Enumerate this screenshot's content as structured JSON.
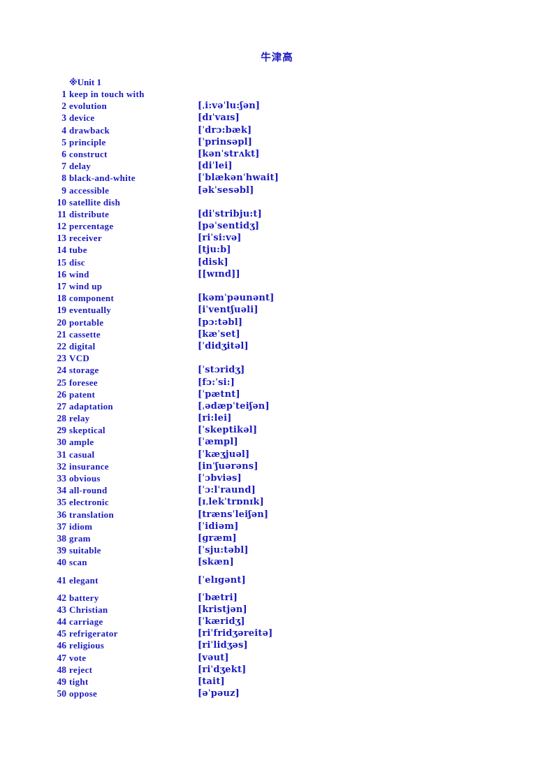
{
  "document": {
    "title": "牛津高",
    "unit_marker": "※",
    "unit_label": "Unit 1",
    "text_color": "#1a1ac0",
    "background_color": "#ffffff"
  },
  "vocab": [
    {
      "num": "1",
      "word": "keep in touch with",
      "ipa": ""
    },
    {
      "num": "2",
      "word": "evolution",
      "ipa": "[ˌi:vəˈlu:ʃən]"
    },
    {
      "num": "3",
      "word": "device",
      "ipa": "[dɪˈvaɪs]"
    },
    {
      "num": "4",
      "word": "drawback",
      "ipa": "[ˈdrɔ:bæk]"
    },
    {
      "num": "5",
      "word": "principle",
      "ipa": "[ˈprinsəpl]"
    },
    {
      "num": "6",
      "word": "construct",
      "ipa": "[kənˈstrʌkt]"
    },
    {
      "num": "7",
      "word": "delay",
      "ipa": "[diˈlei]"
    },
    {
      "num": "8",
      "word": "black-and-white",
      "ipa": "[ˈblækənˈhwait]"
    },
    {
      "num": "9",
      "word": "accessible",
      "ipa": "[əkˈsesəbl]"
    },
    {
      "num": "10",
      "word": "satellite dish",
      "ipa": ""
    },
    {
      "num": "11",
      "word": "distribute",
      "ipa": "[diˈstribju:t]"
    },
    {
      "num": "12",
      "word": "percentage",
      "ipa": "[pəˈsentidʒ]"
    },
    {
      "num": "13",
      "word": "receiver",
      "ipa": "[riˈsi:və]"
    },
    {
      "num": "14",
      "word": "tube",
      "ipa": "[tju:b]"
    },
    {
      "num": "15",
      "word": "disc",
      "ipa": "[disk]"
    },
    {
      "num": "16",
      "word": "wind",
      "ipa": "[[wɪnd]]"
    },
    {
      "num": "17",
      "word": "wind up",
      "ipa": ""
    },
    {
      "num": "18",
      "word": "component",
      "ipa": "[kəmˈpəunənt]"
    },
    {
      "num": "19",
      "word": "eventually",
      "ipa": "[iˈventʃuəli]"
    },
    {
      "num": "20",
      "word": "portable",
      "ipa": "[pɔ:təbl]"
    },
    {
      "num": "21",
      "word": "cassette",
      "ipa": "[kæˈset]"
    },
    {
      "num": "22",
      "word": "digital",
      "ipa": "[ˈdidʒitəl]"
    },
    {
      "num": "23",
      "word": "VCD",
      "ipa": ""
    },
    {
      "num": "24",
      "word": "storage",
      "ipa": "[ˈstɔridʒ]"
    },
    {
      "num": "25",
      "word": "foresee",
      "ipa": "[fɔ:ˈsi:]"
    },
    {
      "num": "26",
      "word": "patent",
      "ipa": "[ˈpætnt]"
    },
    {
      "num": "27",
      "word": "adaptation",
      "ipa": "[ˌədæpˈteiʃən]"
    },
    {
      "num": "28",
      "word": "relay",
      "ipa": "[ri:lei]"
    },
    {
      "num": "29",
      "word": "skeptical",
      "ipa": "[ˈskeptikəl]"
    },
    {
      "num": "30",
      "word": "ample",
      "ipa": "[ˈæmpl]"
    },
    {
      "num": "31",
      "word": "casual",
      "ipa": "[ˈkæʒjuəl]"
    },
    {
      "num": "32",
      "word": "insurance",
      "ipa": "[inˈʃuərəns]"
    },
    {
      "num": "33",
      "word": "obvious",
      "ipa": "[ˈɔbviəs]"
    },
    {
      "num": "34",
      "word": "all-round",
      "ipa": "[ˈɔ:lˈraund]"
    },
    {
      "num": "35",
      "word": "electronic",
      "ipa": "[ɪˌlekˈtrɒnɪk]"
    },
    {
      "num": "36",
      "word": "translation",
      "ipa": "[trænsˈleiʃən]"
    },
    {
      "num": "37",
      "word": "idiom",
      "ipa": "[ˈidiəm]"
    },
    {
      "num": "38",
      "word": "gram",
      "ipa": "[ɡræm]"
    },
    {
      "num": "39",
      "word": "suitable",
      "ipa": "[ˈsju:təbl]"
    },
    {
      "num": "40",
      "word": "scan",
      "ipa": "[skæn]"
    },
    {
      "num": "41",
      "word": "elegant",
      "ipa": "[ˈelɪgənt]",
      "gap_before": true
    },
    {
      "num": "42",
      "word": "battery",
      "ipa": "[ˈbætri]",
      "gap_before": true
    },
    {
      "num": "43",
      "word": "Christian",
      "ipa": "[kristjən]"
    },
    {
      "num": "44",
      "word": "carriage",
      "ipa": "[ˈkæridʒ]"
    },
    {
      "num": "45",
      "word": "refrigerator",
      "ipa": "[riˈfridʒəreitə]"
    },
    {
      "num": "46",
      "word": "religious",
      "ipa": "[riˈlidʒəs]"
    },
    {
      "num": "47",
      "word": "vote",
      "ipa": "[vəut]"
    },
    {
      "num": "48",
      "word": "reject",
      "ipa": "[riˈdʒekt]"
    },
    {
      "num": "49",
      "word": "tight",
      "ipa": "[tait]"
    },
    {
      "num": "50",
      "word": "oppose",
      "ipa": "[əˈpəuz]"
    }
  ]
}
